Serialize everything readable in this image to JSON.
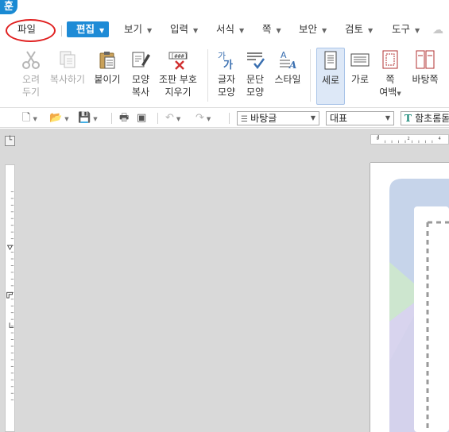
{
  "app_icon": "훈",
  "menubar": {
    "file": "파일",
    "edit": "편집",
    "view": "보기",
    "insert": "입력",
    "format": "서식",
    "page": "쪽",
    "security": "보안",
    "review": "검토",
    "tools": "도구"
  },
  "ribbon": {
    "cut": [
      "오려",
      "두기"
    ],
    "copy": "복사하기",
    "paste": "붙이기",
    "format_copy": [
      "모양",
      "복사"
    ],
    "clear_format": [
      "조판 부호",
      "지우기"
    ],
    "char_shape": [
      "글자",
      "모양"
    ],
    "para_shape": [
      "문단",
      "모양"
    ],
    "style": "스타일",
    "portrait": "세로",
    "landscape": "가로",
    "page_margin": [
      "쪽",
      "여백"
    ],
    "page_background": "바탕쪽"
  },
  "toolbar2": {
    "style_select": "바탕글",
    "font_category": "대표",
    "font_name": "함초롬돋"
  },
  "colors": {
    "accent": "#1e8bd6",
    "highlight_circle": "#e02020",
    "workarea": "#d9d9d9"
  },
  "icons": [
    "scissors-icon",
    "copy-icon",
    "paste-icon",
    "format-brush-icon",
    "clear-marks-icon",
    "char-shape-icon",
    "para-shape-icon",
    "style-icon",
    "portrait-icon",
    "landscape-icon",
    "page-margin-icon",
    "page-background-icon",
    "new-doc-icon",
    "open-folder-icon",
    "save-icon",
    "print-icon",
    "preview-icon",
    "undo-icon",
    "redo-icon",
    "cloud-icon"
  ]
}
